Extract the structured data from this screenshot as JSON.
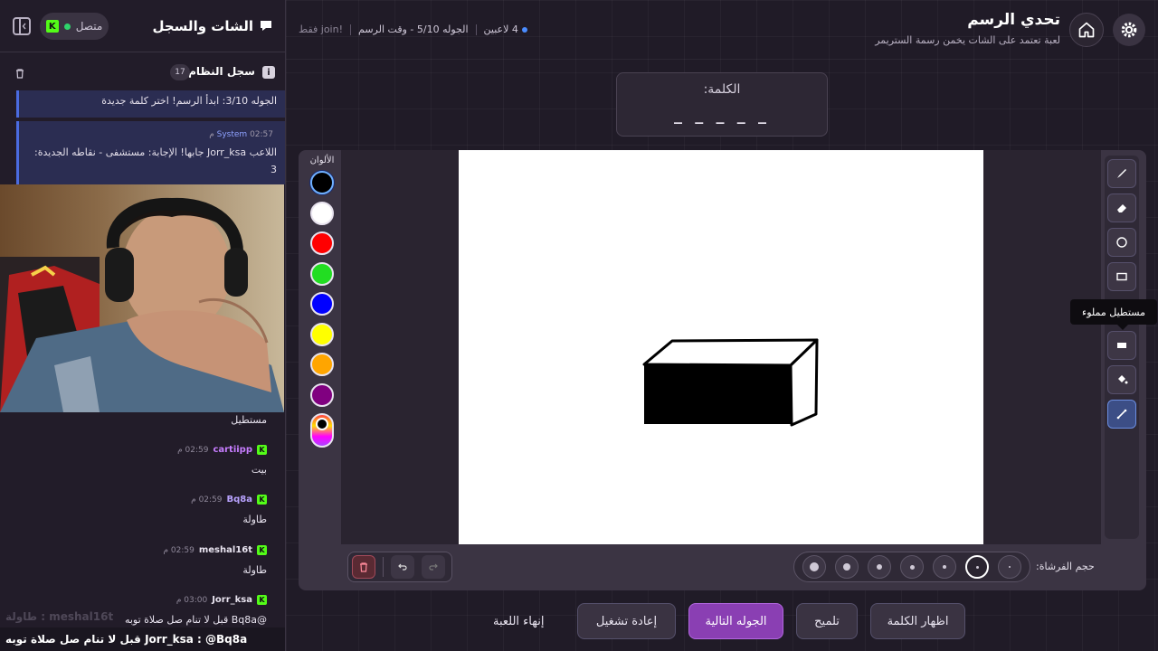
{
  "header": {
    "title": "تحدي الرسم",
    "subtitle": "لعبة تعتمد على الشات يخمن رسمة الستريمر",
    "players": "4 لاعبين",
    "round": "الجوله 5/10 - وقت الرسم",
    "join_hint": "!join فقط"
  },
  "word": {
    "label": "الكلمة:",
    "mask": "_ _ _ _ _"
  },
  "colors": {
    "label": "الألوان",
    "swatches": [
      "#000000",
      "#ffffff",
      "#ff0000",
      "#22dd22",
      "#0000ff",
      "#ffff00",
      "#ffa500",
      "#800080"
    ],
    "selected": "#000000"
  },
  "tools": {
    "items": [
      "brush-icon",
      "eraser-icon",
      "circle-icon",
      "rectangle-icon",
      "filled-rectangle-icon",
      "fill-bucket-icon",
      "line-icon"
    ],
    "tooltip": "مستطيل مملوء",
    "active": "line-icon"
  },
  "brush": {
    "label": "حجم الفرشاة:",
    "selected_index": 5
  },
  "buttons": {
    "reveal": "اظهار الكلمة",
    "hint": "تلميح",
    "next_round": "الجوله التالية",
    "restart": "إعادة تشغيل",
    "end_game": "إنهاء اللعبة"
  },
  "sidebar": {
    "title": "الشات والسجل",
    "online": "متصل",
    "syslog_title": "سجل النظام",
    "syslog_count": "17",
    "system_messages": [
      {
        "text": "الجوله 3/10: ابدأ الرسم! اختر كلمة جديدة"
      },
      {
        "sender": "System",
        "time": "02:57 م",
        "text": "اللاعب Jorr_ksa جابها! الإجابة: مستشفى - نقاطه الجديدة: 3"
      }
    ],
    "chat": [
      {
        "user": "",
        "time": "",
        "text": "مستطيل",
        "color": "#e9e4f0"
      },
      {
        "user": "cartiipp",
        "time": "02:59 م",
        "text": "بيت",
        "color": "#c77dff"
      },
      {
        "user": "Bq8a",
        "time": "02:59 م",
        "text": "طاولة",
        "color": "#b9a3ff"
      },
      {
        "user": "meshal16t",
        "time": "02:59 م",
        "text": "طاولة",
        "color": "#e9e4f0"
      },
      {
        "user": "Jorr_ksa",
        "time": "03:00 م",
        "text": "@Bq8a قبل لا تنام صل صلاة توبه",
        "color": "#e9e4f0"
      }
    ],
    "ticker_ghost": "meshal16t : طاولة",
    "ticker": "Jorr_ksa : @Bq8a قبل لا تنام صل صلاة توبه"
  }
}
